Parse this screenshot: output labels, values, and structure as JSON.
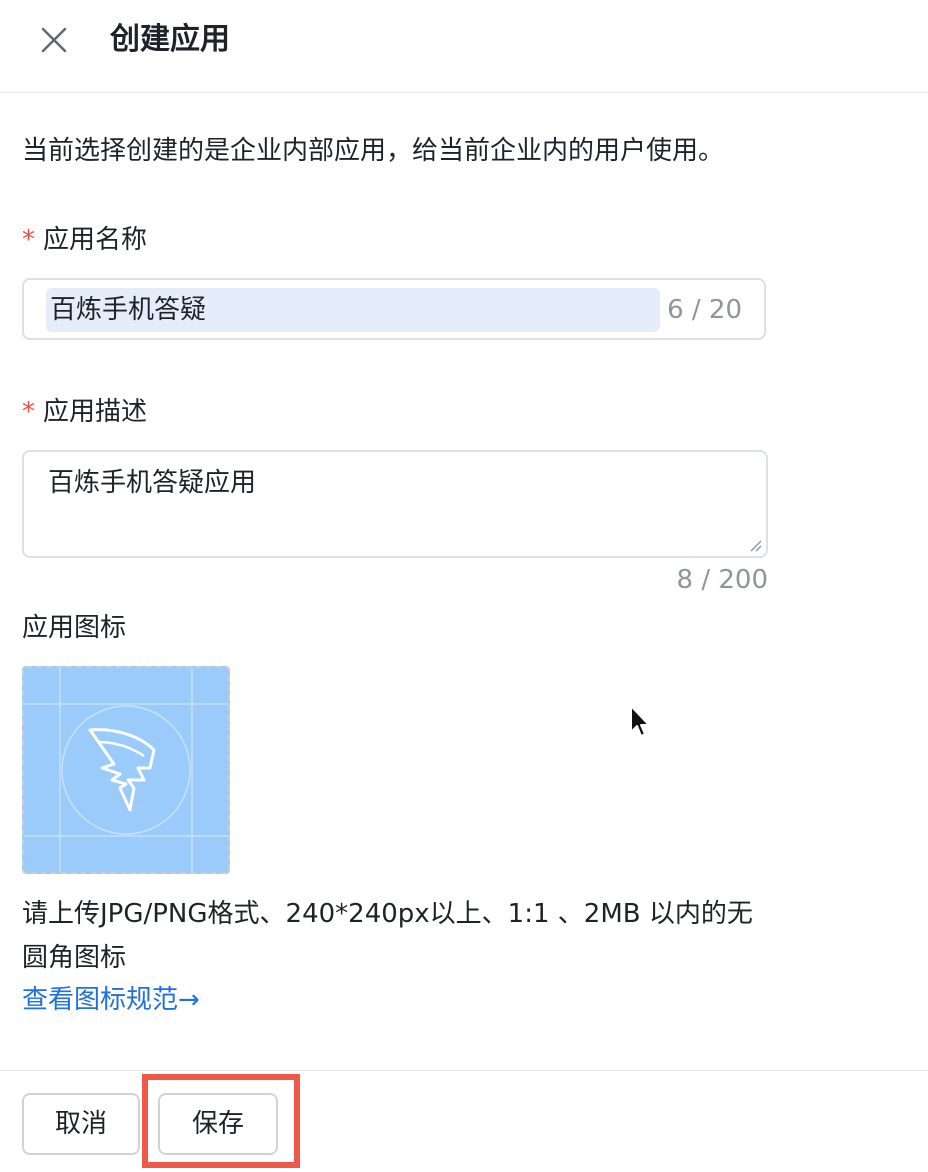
{
  "header": {
    "title": "创建应用",
    "close_icon": "close-icon"
  },
  "intro_text": "当前选择创建的是企业内部应用，给当前企业内的用户使用。",
  "form": {
    "required_mark": "*",
    "app_name": {
      "label": "应用名称",
      "value": "百炼手机答疑",
      "counter": "6 / 20"
    },
    "app_description": {
      "label": "应用描述",
      "value": "百炼手机答疑应用",
      "counter": "8 / 200"
    },
    "app_icon": {
      "label": "应用图标",
      "icon_name": "dingtalk-wing-icon",
      "background_color": "#9acbfa",
      "hint": "请上传JPG/PNG格式、240*240px以上、1:1 、2MB 以内的无圆角图标",
      "spec_link": "查看图标规范→"
    }
  },
  "footer": {
    "cancel_label": "取消",
    "save_label": "保存",
    "highlight_color": "#f0584a"
  },
  "colors": {
    "accent": "#1f6fe5",
    "required": "#f54a45",
    "counter_text": "#8f959e"
  }
}
